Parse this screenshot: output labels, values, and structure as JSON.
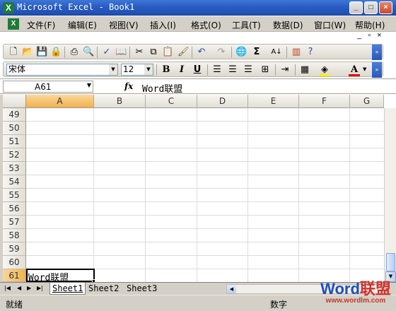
{
  "window": {
    "title": "Microsoft Excel - Book1",
    "app_icon": "excel-icon"
  },
  "menubar": {
    "items": [
      "文件(F)",
      "编辑(E)",
      "视图(V)",
      "插入(I)",
      "格式(O)",
      "工具(T)",
      "数据(D)",
      "窗口(W)",
      "帮助(H)"
    ],
    "doc_controls": [
      "_",
      "▫",
      "×"
    ]
  },
  "toolbar_standard": {
    "icons": [
      "new-icon",
      "open-icon",
      "save-icon",
      "permission-icon",
      "print-icon",
      "print-preview-icon",
      "spelling-icon",
      "research-icon",
      "cut-icon",
      "copy-icon",
      "paste-icon",
      "format-painter-icon",
      "undo-icon",
      "redo-icon",
      "hyperlink-icon",
      "autosum-icon",
      "sort-ascending-icon",
      "chart-wizard-icon",
      "help-icon"
    ]
  },
  "toolbar_formatting": {
    "font_name": "宋体",
    "font_size": "12",
    "bold": "B",
    "italic": "I",
    "underline": "U",
    "font_color": "#e00000",
    "fill_color": "#ffee00"
  },
  "formula_bar": {
    "name_box": "A61",
    "fx": "fx",
    "formula": "Word联盟"
  },
  "grid": {
    "columns": [
      "A",
      "B",
      "C",
      "D",
      "E",
      "F",
      "G"
    ],
    "active_column": "A",
    "rows": [
      "49",
      "50",
      "51",
      "52",
      "53",
      "54",
      "55",
      "56",
      "57",
      "58",
      "59",
      "60",
      "61"
    ],
    "active_row": "61",
    "active_cell_text": "Word联盟"
  },
  "sheets": {
    "tabs": [
      "Sheet1",
      "Sheet2",
      "Sheet3"
    ],
    "active": "Sheet1"
  },
  "status": {
    "left": "就绪",
    "mode": "数字"
  },
  "watermark": {
    "brand_prefix": "Word",
    "brand_suffix": "联盟",
    "url": "www.wordlm.com"
  }
}
